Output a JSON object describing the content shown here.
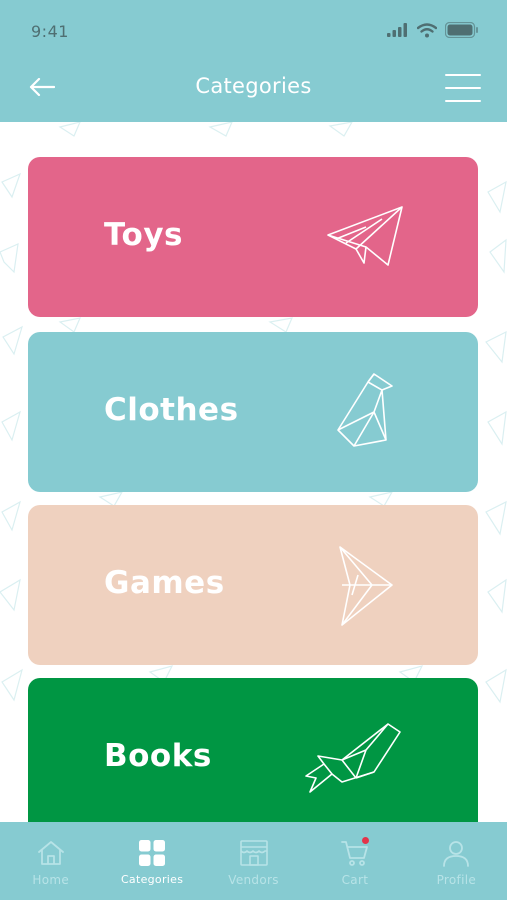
{
  "status_bar": {
    "time": "9:41"
  },
  "header": {
    "title": "Categories"
  },
  "categories": [
    {
      "label": "Toys",
      "color": "#e3658a",
      "icon": "paper-plane-icon"
    },
    {
      "label": "Clothes",
      "color": "#86cbd1",
      "icon": "origami-penguin-icon"
    },
    {
      "label": "Games",
      "color": "#efd1bf",
      "icon": "origami-fish-icon"
    },
    {
      "label": "Books",
      "color": "#009643",
      "icon": "origami-whale-icon"
    }
  ],
  "tabbar": {
    "active": "Categories",
    "tabs": [
      {
        "label": "Home",
        "icon": "home-icon"
      },
      {
        "label": "Categories",
        "icon": "grid-icon"
      },
      {
        "label": "Vendors",
        "icon": "storefront-icon"
      },
      {
        "label": "Cart",
        "icon": "cart-icon"
      },
      {
        "label": "Profile",
        "icon": "user-icon"
      }
    ]
  },
  "colors": {
    "header_bg": "#86cbd1",
    "tabbar_bg": "#86cbd1",
    "cart_badge": "#e3344a"
  }
}
